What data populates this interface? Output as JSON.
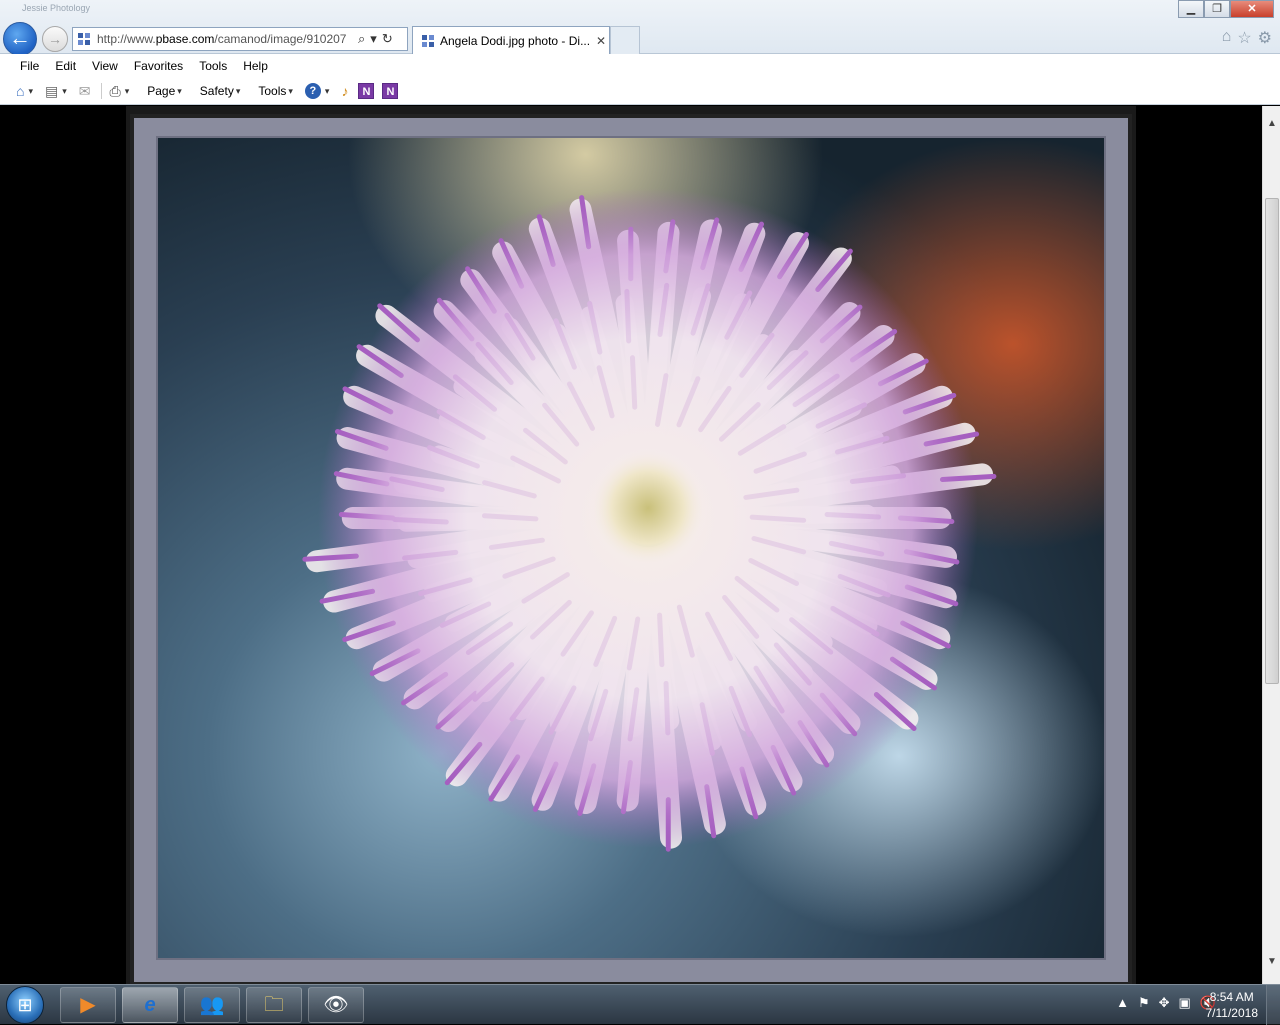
{
  "browser": {
    "address_prefix": "http://www.",
    "address_domain": "pbase.com",
    "address_path": "/camanod/image/910207",
    "tab_title": "Angela Dodi.jpg photo - Di...",
    "ghost_title": "Jessie Photology",
    "back_glyph": "←",
    "forward_glyph": "→",
    "tab_close_glyph": "✕",
    "search_glyph": "⌕",
    "dropdown_glyph": "▾",
    "refresh_glyph": "↻",
    "home_glyph": "⌂",
    "favorites_glyph": "☆",
    "settings_glyph": "⚙",
    "minimize_glyph": "▁",
    "maximize_glyph": "❐",
    "close_glyph": "✕"
  },
  "menubar": {
    "items": [
      "File",
      "Edit",
      "View",
      "Favorites",
      "Tools",
      "Help"
    ]
  },
  "commandbar": {
    "home_glyph": "⌂",
    "feeds_glyph": "▤",
    "mail_glyph": "✉",
    "print_glyph": "⎙",
    "dropdown_glyph": "▾",
    "page_label": "Page",
    "safety_label": "Safety",
    "tools_label": "Tools",
    "help_glyph": "?",
    "research_glyph": "♪",
    "onenote_1": "N",
    "onenote_2": "N"
  },
  "photo": {
    "subject": "white dahlia with purple petal tips"
  },
  "scrollbar": {
    "up_glyph": "▲",
    "down_glyph": "▼"
  },
  "taskbar": {
    "start_glyph": "⊞",
    "apps": [
      {
        "name": "media-player",
        "glyph": "▶"
      },
      {
        "name": "internet-explorer",
        "glyph": "e"
      },
      {
        "name": "messenger",
        "glyph": "👥"
      },
      {
        "name": "file-explorer",
        "glyph": "🗀"
      },
      {
        "name": "photo-app",
        "glyph": "👁"
      }
    ],
    "tray_icons": [
      "▲",
      "⚑",
      "✥",
      "▣",
      "🔇"
    ],
    "time": "8:54 AM",
    "date": "7/11/2018"
  },
  "colors": {
    "taskbar": "#2b3642",
    "mat": "#8a8c9e",
    "petal_tip": "#a65fc0",
    "petal_base": "#f4eef0"
  }
}
